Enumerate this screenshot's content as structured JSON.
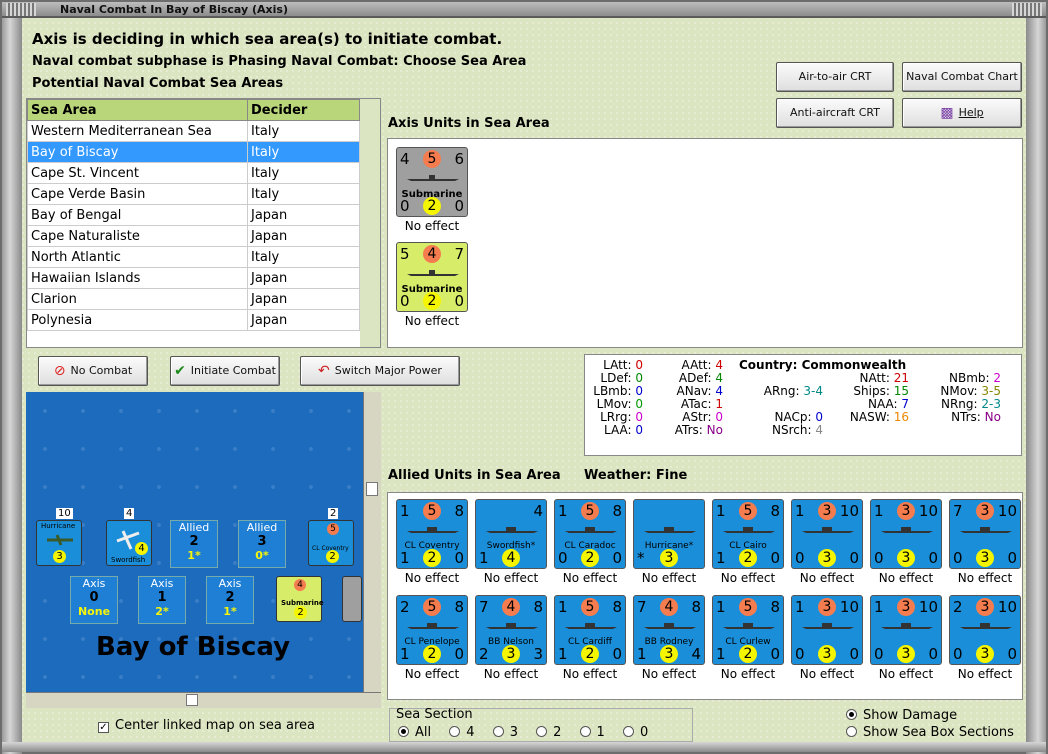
{
  "window": {
    "title": "Naval Combat In Bay of Biscay (Axis)"
  },
  "headings": {
    "line1": "Axis is deciding in which sea area(s) to initiate combat.",
    "line2": "Naval combat subphase is Phasing Naval Combat: Choose Sea Area",
    "line3": "Potential Naval Combat Sea Areas"
  },
  "top_buttons": {
    "air_to_air": "Air-to-air CRT",
    "naval_chart": "Naval Combat Chart",
    "anti_aircraft": "Anti-aircraft CRT",
    "help": "Help"
  },
  "sea_table": {
    "headers": [
      "Sea Area",
      "Decider"
    ],
    "rows": [
      {
        "area": "Western Mediterranean Sea",
        "decider": "Italy"
      },
      {
        "area": "Bay of Biscay",
        "decider": "Italy"
      },
      {
        "area": "Cape St. Vincent",
        "decider": "Italy"
      },
      {
        "area": "Cape Verde Basin",
        "decider": "Italy"
      },
      {
        "area": "Bay of Bengal",
        "decider": "Japan"
      },
      {
        "area": "Cape Naturaliste",
        "decider": "Japan"
      },
      {
        "area": "North Atlantic",
        "decider": "Italy"
      },
      {
        "area": "Hawaiian Islands",
        "decider": "Japan"
      },
      {
        "area": "Clarion",
        "decider": "Japan"
      },
      {
        "area": "Polynesia",
        "decider": "Japan"
      }
    ]
  },
  "axis_panel": {
    "label": "Axis Units in Sea Area",
    "units": [
      {
        "name": "Submarine",
        "tl": "4",
        "tc": "5",
        "tr": "6",
        "bl": "0",
        "bc": "2",
        "br": "0",
        "status": "No effect"
      },
      {
        "name": "Submarine",
        "tl": "5",
        "tc": "4",
        "tr": "7",
        "bl": "0",
        "bc": "2",
        "br": "0",
        "status": "No effect"
      }
    ]
  },
  "actions": {
    "no_combat": "No Combat",
    "initiate": "Initiate Combat",
    "switch": "Switch Major Power"
  },
  "stats": {
    "country_label": "Country: Commonwealth",
    "col1": [
      "LAtt: ",
      "LDef: ",
      "LBmb: ",
      "LMov: ",
      "LRrg: ",
      "LAA: "
    ],
    "col1v": [
      "0",
      "0",
      "0",
      "0",
      "0",
      "0"
    ],
    "col2": [
      "AAtt: ",
      "ADef: ",
      "ANav: ",
      "ATac: ",
      "AStr: ",
      "ATrs: "
    ],
    "col2v": [
      "4",
      "4",
      "4",
      "1",
      "0",
      "No"
    ],
    "col3": [
      "ARng: ",
      "NACp: ",
      "NSrch: "
    ],
    "col3v": [
      "3-4",
      "0",
      "4"
    ],
    "col4": [
      "NAtt: ",
      "Ships: ",
      "NAA: ",
      "NASW: "
    ],
    "col4v": [
      "21",
      "15",
      "7",
      "16"
    ],
    "col5": [
      "NBmb: ",
      "NMov: ",
      "NRng: ",
      "NTrs: "
    ],
    "col5v": [
      "2",
      "3-5",
      "2-3",
      "No"
    ]
  },
  "allied_panel": {
    "label": "Allied Units in Sea Area",
    "weather_label": "Weather:  Fine",
    "row1": [
      {
        "name": "CL Coventry",
        "tl": "1",
        "tc": "5",
        "tr": "8",
        "bl": "1",
        "bc": "2",
        "br": "0",
        "status": "No effect"
      },
      {
        "name": "Swordfish*",
        "tl": "",
        "tc": "",
        "tr": "4",
        "bl": "1",
        "bc": "4",
        "br": "",
        "status": "No effect"
      },
      {
        "name": "CL Caradoc",
        "tl": "1",
        "tc": "5",
        "tr": "8",
        "bl": "0",
        "bc": "2",
        "br": "0",
        "status": "No effect"
      },
      {
        "name": "Hurricane*",
        "tl": "",
        "tc": "",
        "tr": "",
        "bl": "*",
        "bc": "3",
        "br": "",
        "status": "No effect"
      },
      {
        "name": "CL Cairo",
        "tl": "1",
        "tc": "5",
        "tr": "8",
        "bl": "1",
        "bc": "2",
        "br": "0",
        "status": "No effect"
      },
      {
        "name": "",
        "tl": "1",
        "tc": "3",
        "tr": "10",
        "bl": "0",
        "bc": "3",
        "br": "0",
        "status": "No effect"
      },
      {
        "name": "",
        "tl": "1",
        "tc": "3",
        "tr": "10",
        "bl": "0",
        "bc": "3",
        "br": "0",
        "status": "No effect"
      },
      {
        "name": "",
        "tl": "7",
        "tc": "3",
        "tr": "10",
        "bl": "0",
        "bc": "3",
        "br": "0",
        "status": "No effect"
      }
    ],
    "row2": [
      {
        "name": "CL Penelope",
        "tl": "2",
        "tc": "5",
        "tr": "8",
        "bl": "1",
        "bc": "2",
        "br": "0",
        "status": "No effect"
      },
      {
        "name": "BB Nelson",
        "tl": "7",
        "tc": "4",
        "tr": "8",
        "bl": "2",
        "bc": "3",
        "br": "3",
        "status": "No effect"
      },
      {
        "name": "CL Cardiff",
        "tl": "1",
        "tc": "5",
        "tr": "8",
        "bl": "1",
        "bc": "2",
        "br": "0",
        "status": "No effect"
      },
      {
        "name": "BB Rodney",
        "tl": "7",
        "tc": "4",
        "tr": "8",
        "bl": "1",
        "bc": "3",
        "br": "4",
        "status": "No effect"
      },
      {
        "name": "CL Curlew",
        "tl": "1",
        "tc": "5",
        "tr": "8",
        "bl": "1",
        "bc": "2",
        "br": "0",
        "status": "No effect"
      },
      {
        "name": "",
        "tl": "1",
        "tc": "3",
        "tr": "10",
        "bl": "0",
        "bc": "3",
        "br": "0",
        "status": "No effect"
      },
      {
        "name": "",
        "tl": "1",
        "tc": "3",
        "tr": "10",
        "bl": "0",
        "bc": "3",
        "br": "0",
        "status": "No effect"
      },
      {
        "name": "",
        "tl": "2",
        "tc": "3",
        "tr": "10",
        "bl": "0",
        "bc": "3",
        "br": "0",
        "status": "No effect"
      }
    ]
  },
  "map": {
    "sea_name": "Bay of Biscay",
    "hurricane_count": "10",
    "swordfish_count": "4",
    "coventry_count": "2",
    "allied1": {
      "label": "Allied",
      "v": "2",
      "s": "1*"
    },
    "allied2": {
      "label": "Allied",
      "v": "3",
      "s": "0*"
    },
    "axis1": {
      "label": "Axis",
      "v": "0",
      "s": "None"
    },
    "axis2": {
      "label": "Axis",
      "v": "1",
      "s": "2*"
    },
    "axis3": {
      "label": "Axis",
      "v": "2",
      "s": "1*"
    }
  },
  "bottom": {
    "center_map": "Center linked map on sea area",
    "sea_section": "Sea Section",
    "options": [
      "All",
      "4",
      "3",
      "2",
      "1",
      "0"
    ],
    "show_damage": "Show Damage",
    "show_sections": "Show Sea Box Sections"
  }
}
